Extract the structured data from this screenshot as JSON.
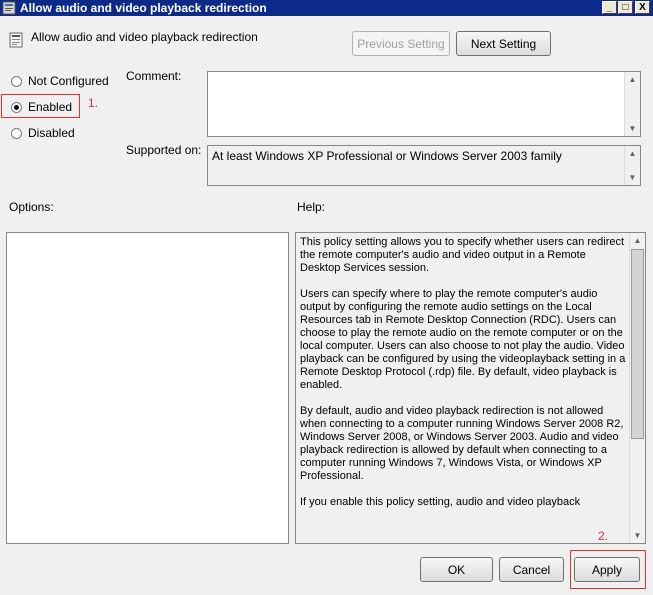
{
  "window": {
    "title": "Allow audio and video playback redirection",
    "minimize_glyph": "_",
    "maximize_glyph": "□",
    "close_glyph": "X"
  },
  "header": {
    "title": "Allow audio and video playback redirection",
    "previous_label": "Previous Setting",
    "next_label": "Next Setting"
  },
  "state": {
    "options": [
      {
        "label": "Not Configured",
        "selected": false
      },
      {
        "label": "Enabled",
        "selected": true
      },
      {
        "label": "Disabled",
        "selected": false
      }
    ]
  },
  "comment": {
    "label": "Comment:",
    "value": ""
  },
  "supported": {
    "label": "Supported on:",
    "value": "At least Windows XP Professional or Windows Server 2003 family"
  },
  "options_panel": {
    "label": "Options:"
  },
  "help": {
    "label": "Help:",
    "paragraphs": [
      "This policy setting allows you to specify whether users can redirect the remote computer's audio and video output in a Remote Desktop Services session.",
      "Users can specify where to play the remote computer's audio output by configuring the remote audio settings on the Local Resources tab in Remote Desktop Connection (RDC). Users can choose to play the remote audio on the remote computer or on the local computer. Users can also choose to not play the audio. Video playback can be configured by using the videoplayback setting in a Remote Desktop Protocol (.rdp) file. By default, video playback is enabled.",
      "By default, audio and video playback redirection is not allowed when connecting to a computer running Windows Server 2008 R2, Windows Server 2008, or Windows Server 2003. Audio and video playback redirection is allowed by default when connecting to a computer running Windows 7, Windows Vista, or Windows XP Professional.",
      "If you enable this policy setting, audio and video playback"
    ]
  },
  "footer": {
    "ok_label": "OK",
    "cancel_label": "Cancel",
    "apply_label": "Apply"
  },
  "annotations": {
    "step1": "1.",
    "step2": "2.",
    "color": "#e03030"
  },
  "colors": {
    "titlebar": "#0b2a8a",
    "dialog_bg": "#f0f0f0"
  }
}
